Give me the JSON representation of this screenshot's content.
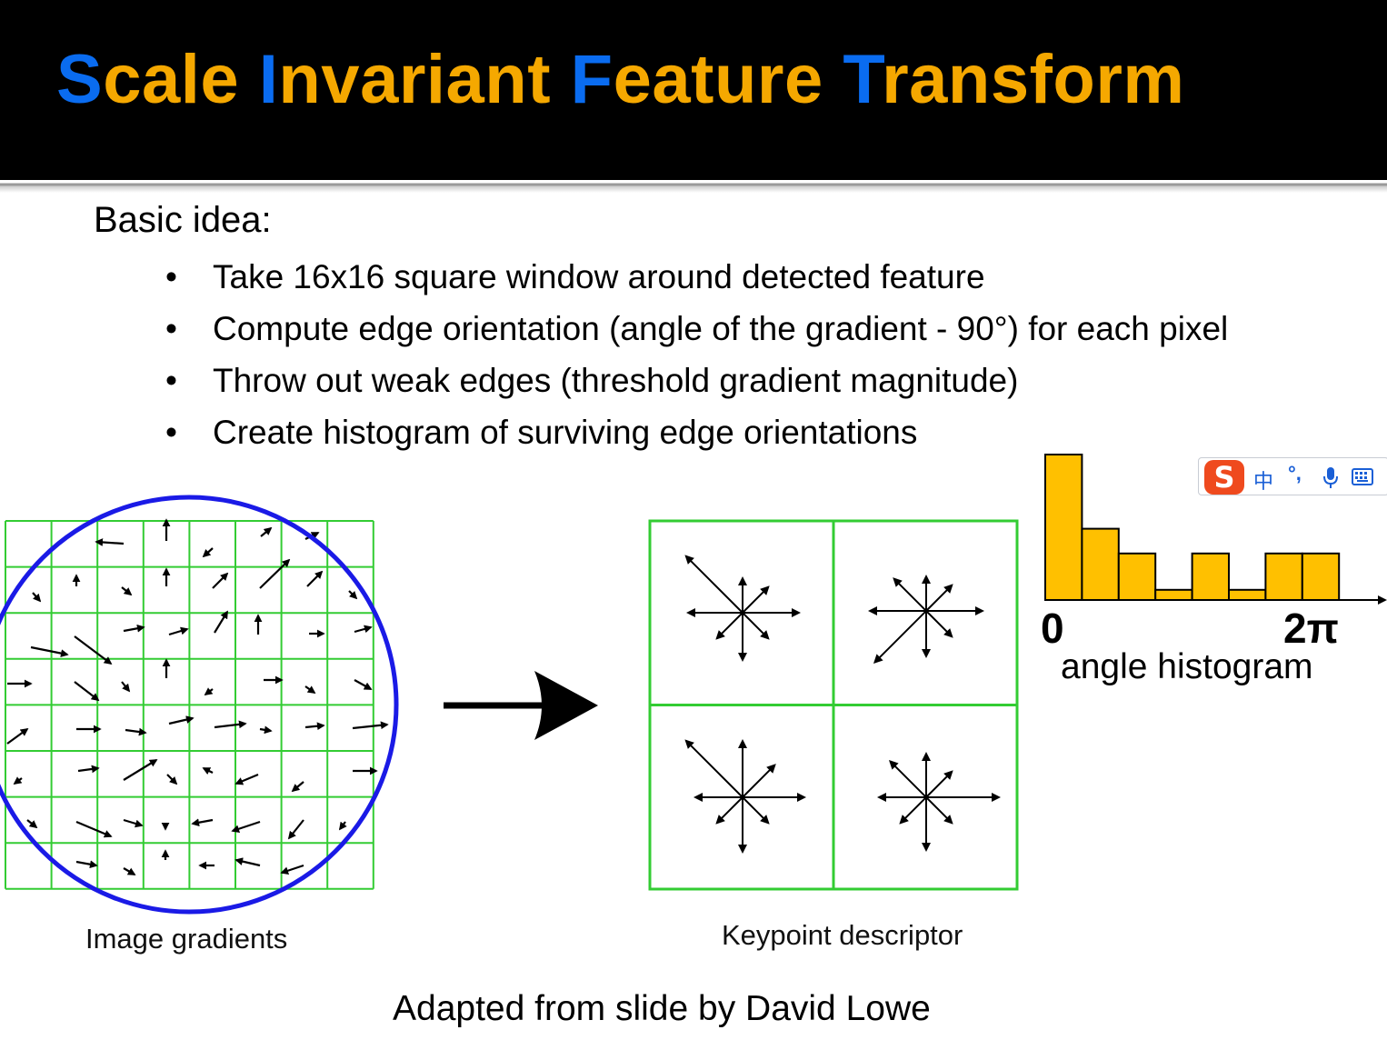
{
  "slide": {
    "title": {
      "words": [
        {
          "cap": "S",
          "rest": "cale"
        },
        {
          "cap": "I",
          "rest": "nvariant"
        },
        {
          "cap": "F",
          "rest": "eature"
        },
        {
          "cap": "T",
          "rest": "ransform"
        }
      ]
    },
    "intro": "Basic idea:",
    "bullets": [
      "Take 16x16 square window around detected feature",
      "Compute edge orientation (angle of the gradient - 90°) for each pixel",
      "Throw out weak edges (threshold gradient magnitude)",
      "Create histogram of surviving edge orientations"
    ],
    "bullet_symbol": "•",
    "figure": {
      "gradients_label": "Image gradients",
      "descriptor_label": "Keypoint descriptor",
      "histogram": {
        "start_label": "0",
        "end_label": "2π",
        "caption": "angle histogram",
        "bar_color": "#ffc000",
        "relative_heights": [
          1.0,
          0.49,
          0.32,
          0.07,
          0.32,
          0.07,
          0.32,
          0.32
        ]
      },
      "grid_color": "#33cc33",
      "circle_color": "#1a1ae6"
    },
    "credit": "Adapted from slide by David Lowe",
    "colors": {
      "title_initial": "#0a6cf0",
      "title_rest": "#f5a800",
      "header_bg": "#000000"
    }
  },
  "ime_toolbar": {
    "logo": "S",
    "language": "中",
    "punctuation": "°,",
    "icons": [
      "microphone-icon",
      "keyboard-icon"
    ]
  }
}
